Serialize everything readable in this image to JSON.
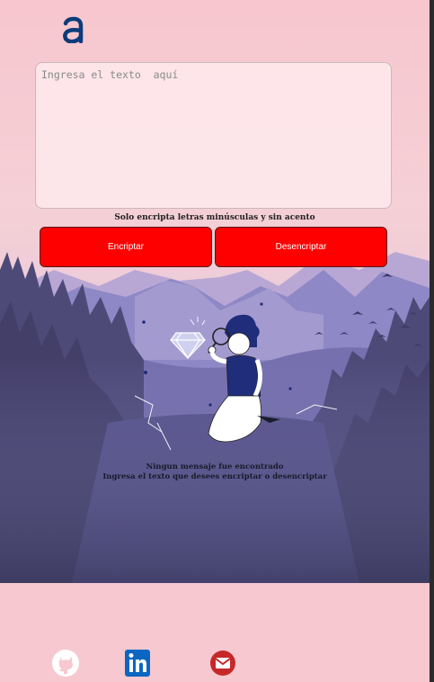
{
  "logo": {
    "letter": "a",
    "icon": "alura-logo-icon",
    "color": "#0b3b7a"
  },
  "input": {
    "placeholder": "Ingresa el texto  aquí",
    "value": ""
  },
  "hint": "Solo encripta letras minúsculas y sin acento",
  "buttons": {
    "encrypt": "Encriptar",
    "decrypt": "Desencriptar"
  },
  "output": {
    "title": "Ningun mensaje fue encontrado",
    "subtitle": "Ingresa el texto que desees encriptar o desencriptar"
  },
  "footer": {
    "links": [
      {
        "icon": "github-icon"
      },
      {
        "icon": "linkedin-icon"
      },
      {
        "icon": "gmail-icon"
      }
    ]
  },
  "colors": {
    "button": "#ff0000",
    "background": "#f7c8cf",
    "accent": "#0b3b7a"
  }
}
